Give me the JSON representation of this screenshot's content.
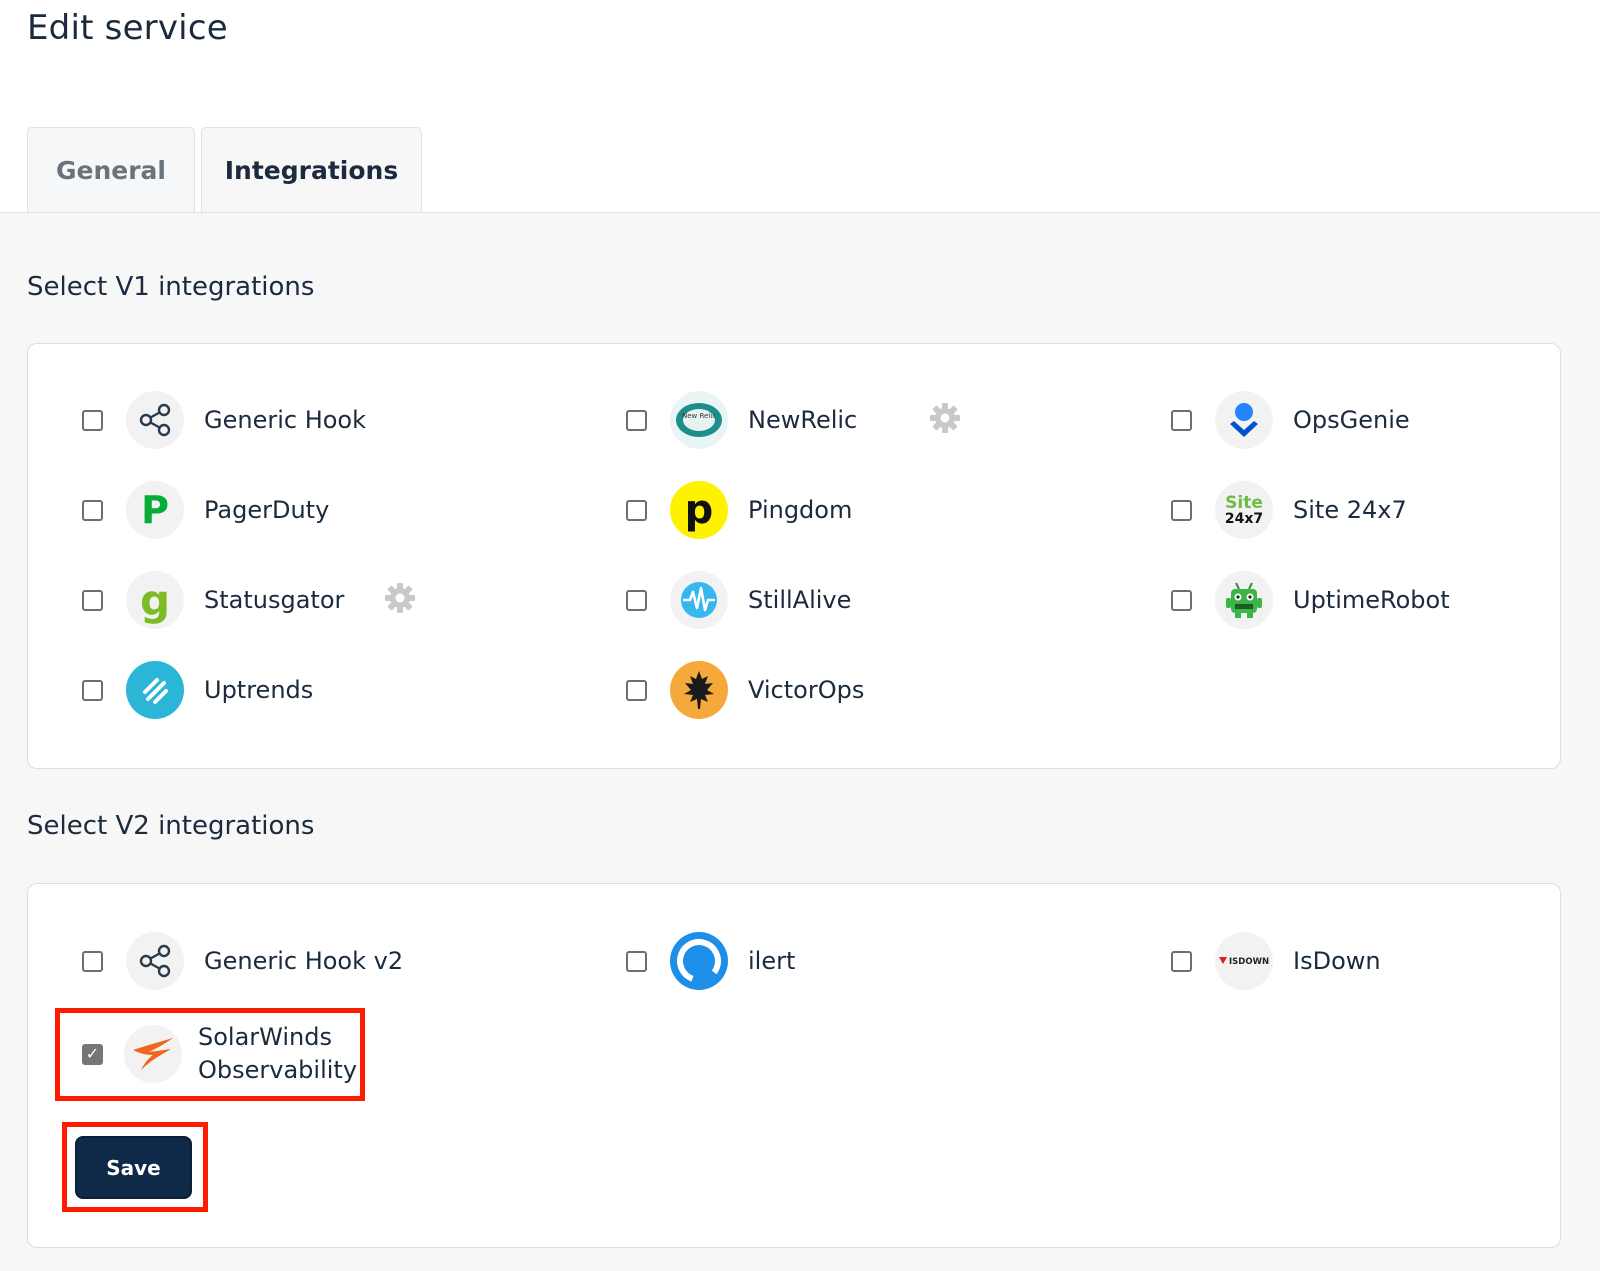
{
  "page": {
    "title": "Edit service"
  },
  "tabs": [
    {
      "label": "General",
      "active": false
    },
    {
      "label": "Integrations",
      "active": true
    }
  ],
  "v1": {
    "title": "Select V1 integrations",
    "items": [
      {
        "label": "Generic Hook",
        "icon": "share-icon",
        "checked": false
      },
      {
        "label": "NewRelic",
        "icon": "newrelic-logo-icon",
        "checked": false,
        "settings": true,
        "logo_text": "New Relic"
      },
      {
        "label": "OpsGenie",
        "icon": "opsgenie-logo-icon",
        "checked": false
      },
      {
        "label": "PagerDuty",
        "icon": "pagerduty-logo-icon",
        "checked": false,
        "logo_text": "P"
      },
      {
        "label": "Pingdom",
        "icon": "pingdom-logo-icon",
        "checked": false,
        "logo_text": "p"
      },
      {
        "label": "Site 24x7",
        "icon": "site24x7-logo-icon",
        "checked": false,
        "logo_text_1": "Site",
        "logo_text_2": "24x7"
      },
      {
        "label": "Statusgator",
        "icon": "statusgator-logo-icon",
        "checked": false,
        "settings": true,
        "logo_text": "g"
      },
      {
        "label": "StillAlive",
        "icon": "stillalive-logo-icon",
        "checked": false
      },
      {
        "label": "UptimeRobot",
        "icon": "uptimerobot-logo-icon",
        "checked": false
      },
      {
        "label": "Uptrends",
        "icon": "uptrends-logo-icon",
        "checked": false
      },
      {
        "label": "VictorOps",
        "icon": "victorops-logo-icon",
        "checked": false
      }
    ]
  },
  "v2": {
    "title": "Select V2 integrations",
    "items": [
      {
        "label": "Generic Hook v2",
        "icon": "share-icon",
        "checked": false
      },
      {
        "label": "ilert",
        "icon": "ilert-logo-icon",
        "checked": false
      },
      {
        "label": "IsDown",
        "icon": "isdown-logo-icon",
        "checked": false,
        "logo_text": "ISDOWN"
      },
      {
        "label": "SolarWinds Observability",
        "icon": "solarwinds-logo-icon",
        "checked": true
      }
    ]
  },
  "actions": {
    "save_label": "Save"
  },
  "colors": {
    "primary": "#0f2a48",
    "highlight": "#ff1a00",
    "panel_bg": "#f7f7f7"
  }
}
